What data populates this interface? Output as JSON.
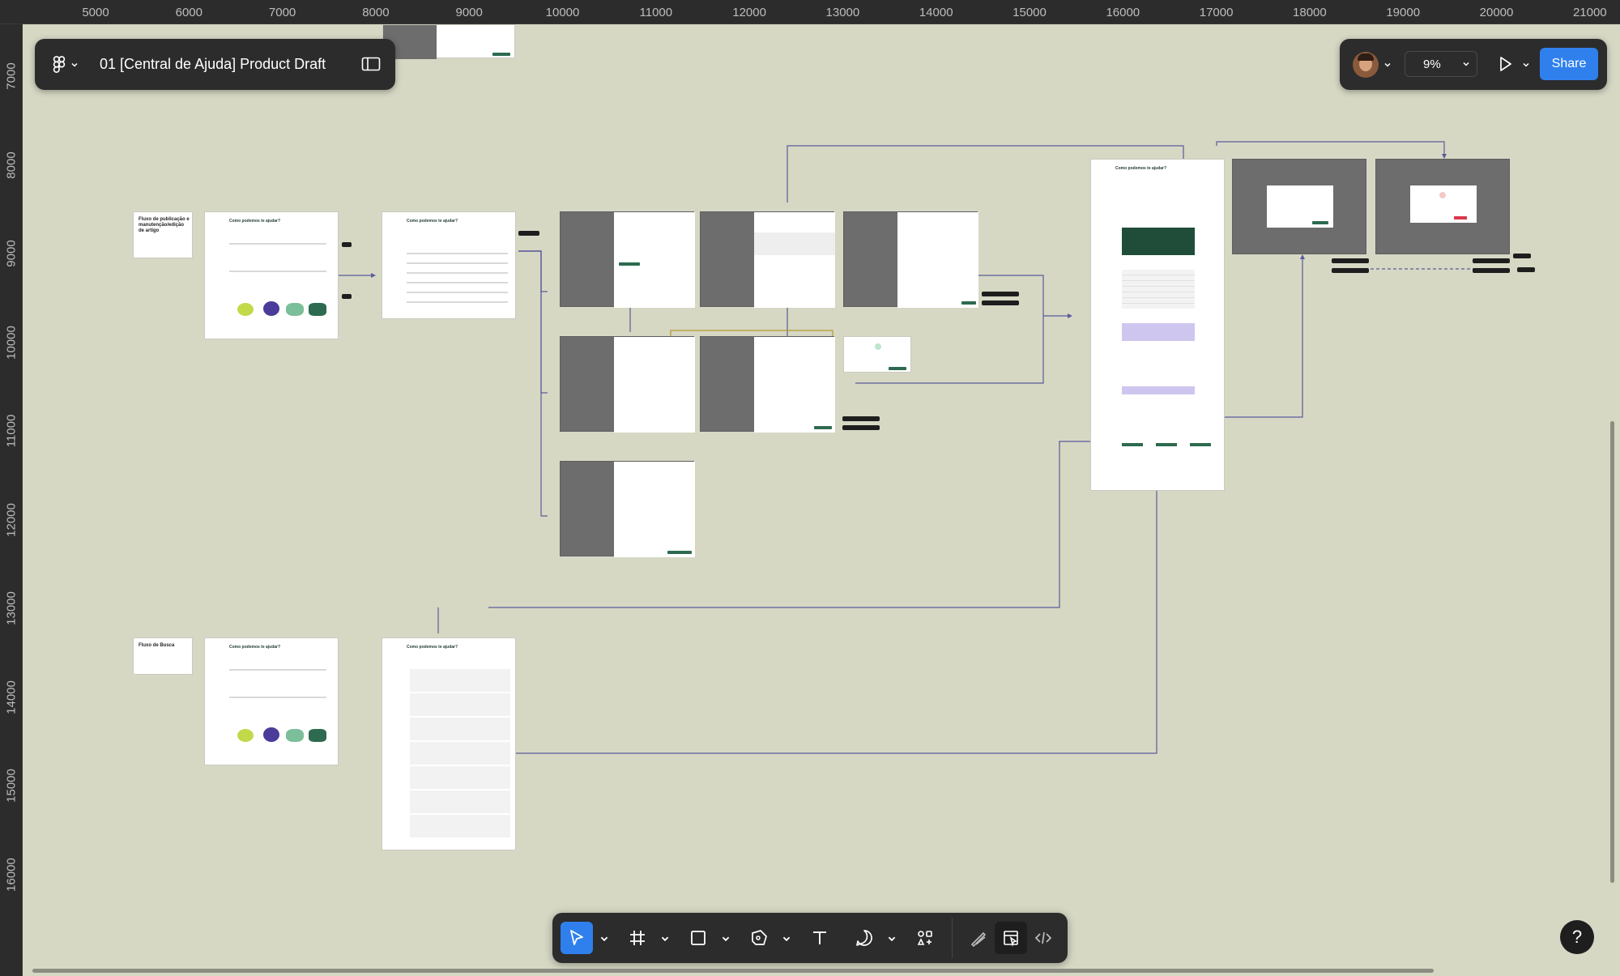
{
  "app": {
    "file_title": "01 [Central de Ajuda] Product Draft",
    "zoom": "9%",
    "share_label": "Share",
    "help_label": "?"
  },
  "rulers": {
    "top": [
      "5000",
      "6000",
      "7000",
      "8000",
      "9000",
      "10000",
      "11000",
      "12000",
      "13000",
      "14000",
      "15000",
      "16000",
      "17000",
      "18000",
      "19000",
      "20000",
      "21000"
    ],
    "left": [
      "7000",
      "8000",
      "9000",
      "10000",
      "11000",
      "12000",
      "13000",
      "14000",
      "15000",
      "16000"
    ]
  },
  "canvas": {
    "notes": {
      "publish_flow": "Fluxo de publicação e manutenção/edição de artigo",
      "search_flow": "Fluxo de Busca"
    },
    "frame_header": "Como podemos te ajudar?"
  },
  "toolbar": {
    "tools": [
      "move-tool",
      "frame-tool",
      "rectangle-tool",
      "pen-tool",
      "text-tool",
      "comment-tool",
      "actions-tool"
    ],
    "modes": [
      "draw-mode",
      "design-mode",
      "dev-mode"
    ]
  },
  "colors": {
    "canvas": "#d6d8c4",
    "chrome": "#2c2c2c",
    "accent": "#2f80ed",
    "brand_green": "#2d6a4f",
    "connector": "#5b5b9a",
    "connector_gold": "#b8962e"
  }
}
